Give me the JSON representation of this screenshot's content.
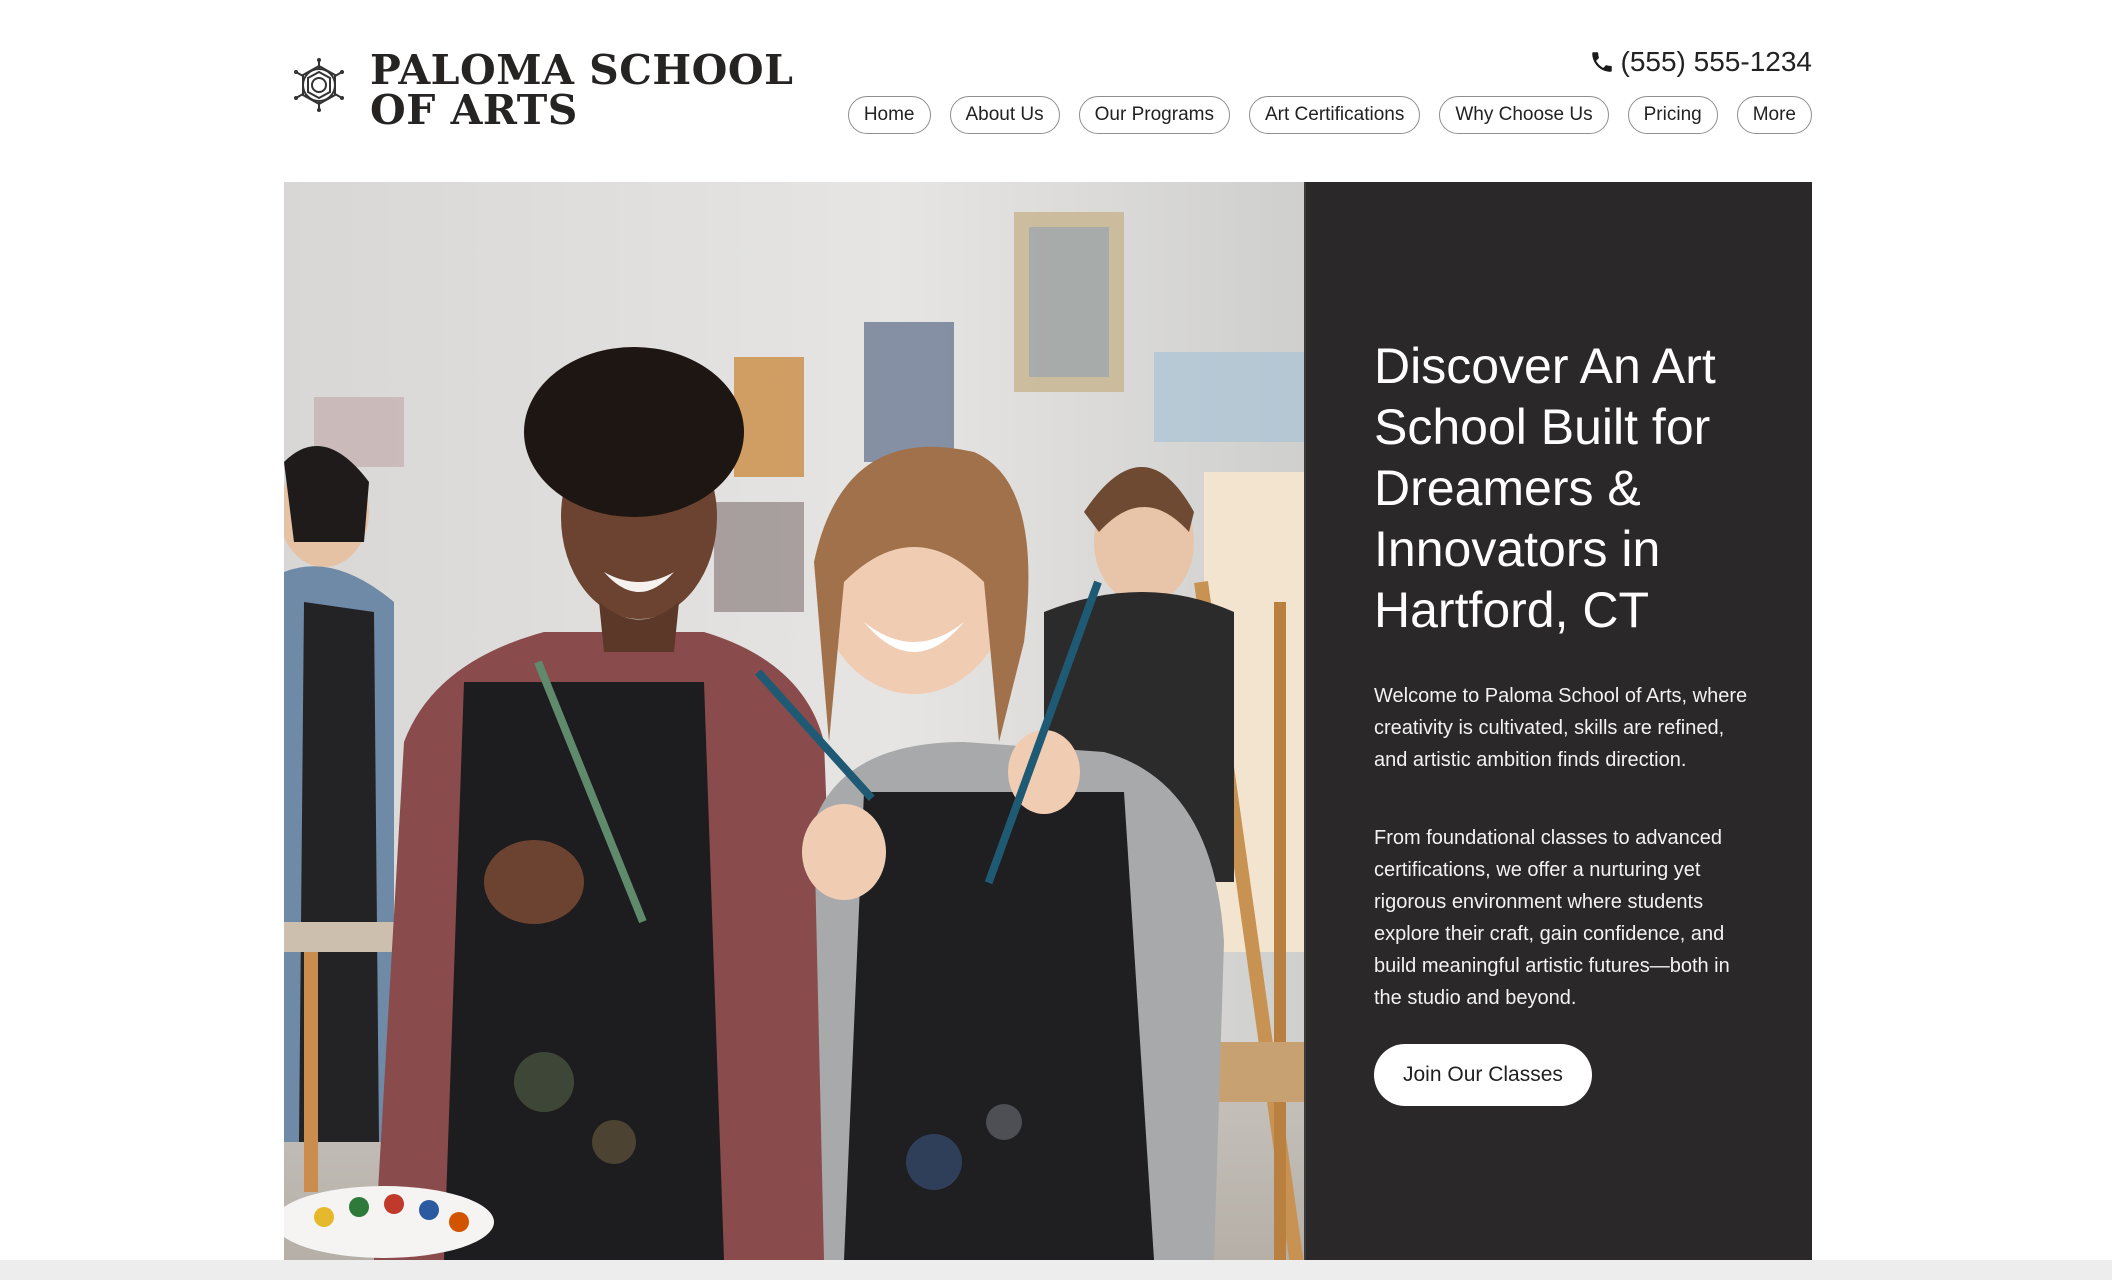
{
  "brand": {
    "name_line1": "PALOMA SCHOOL",
    "name_line2": "OF ARTS",
    "logo_icon": "mandala-icon"
  },
  "contact": {
    "phone": "(555) 555-1234",
    "phone_icon": "phone-icon"
  },
  "nav": {
    "items": [
      {
        "label": "Home"
      },
      {
        "label": "About Us"
      },
      {
        "label": "Our Programs"
      },
      {
        "label": "Art Certifications"
      },
      {
        "label": "Why Choose Us"
      },
      {
        "label": "Pricing"
      },
      {
        "label": "More"
      }
    ]
  },
  "hero": {
    "image_alt": "two-smiling-art-students-with-paintbrushes-in-studio",
    "title": "Discover An Art School Built for Dreamers & Innovators in Hartford, CT",
    "paragraph1": "Welcome to Paloma School of Arts, where creativity is cultivated, skills are refined, and artistic ambition finds direction.",
    "paragraph2": "From foundational classes to advanced certifications, we offer a nurturing yet rigorous environment where students explore their craft, gain confidence, and build meaningful artistic futures—both in the studio and beyond.",
    "cta_label": "Join Our Classes"
  },
  "colors": {
    "panel_bg": "#2a2829",
    "text_dark": "#222222",
    "button_bg": "#ffffff"
  }
}
